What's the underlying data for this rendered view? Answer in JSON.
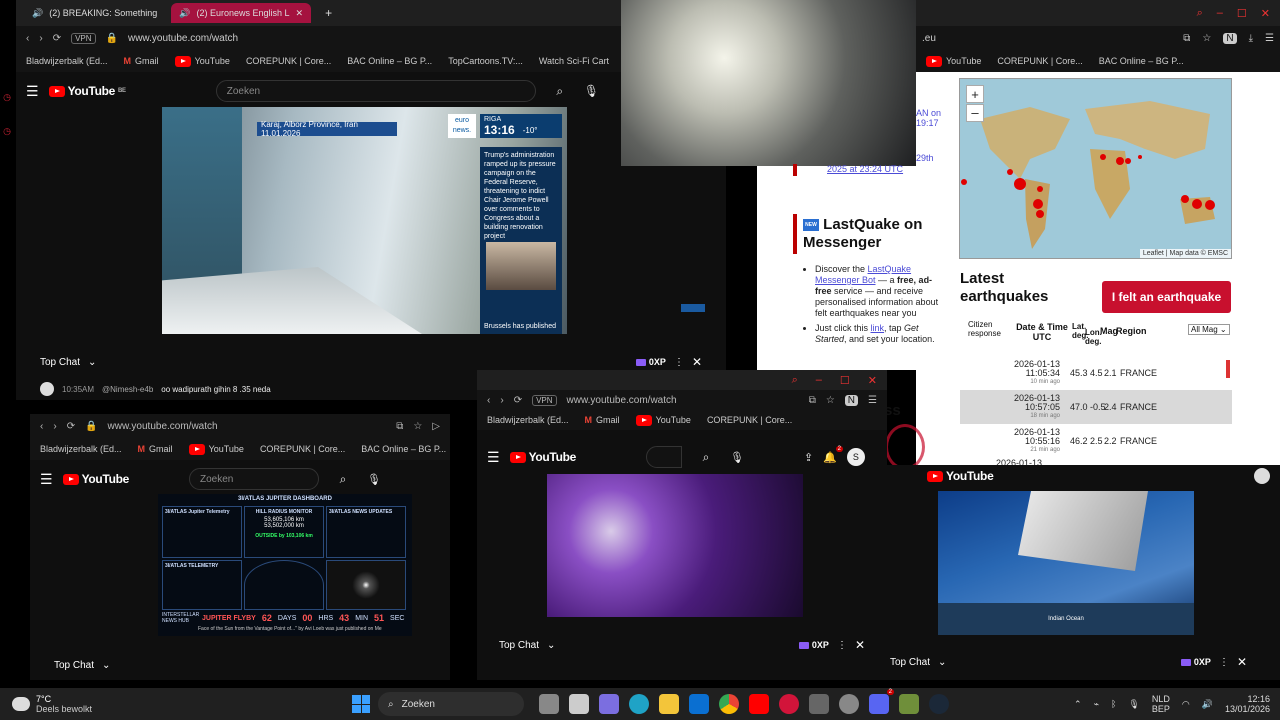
{
  "top_left_window": {
    "tabs": [
      {
        "label": "(2) BREAKING: Something"
      },
      {
        "label": "(2) Euronews English L"
      }
    ],
    "url": "www.youtube.com/watch",
    "vpn": "VPN",
    "bookmarks": [
      "Bladwijzerbalk (Ed...",
      "Gmail",
      "YouTube",
      "COREPUNK | Core...",
      "BAC Online – BG P...",
      "TopCartoons.TV:...",
      "Watch Sci-Fi Cart"
    ],
    "search_placeholder": "Zoeken",
    "yt_label": "YouTube",
    "yt_region": "BE",
    "video": {
      "location": "Karaj, Alborz Province, Iran 11.01.2026",
      "brand": "euro news.",
      "city": "RIGA",
      "time": "13:16",
      "temp": "-10°",
      "news_text": "Trump's administration ramped up its pressure campaign on the Federal Reserve, threatening to indict Chair Jerome Powell over comments to Congress about a building renovation project",
      "bottom_text": "Brussels has published"
    },
    "chat_label": "Top Chat",
    "xp_label": "0XP",
    "chat_message": {
      "time": "10:35AM",
      "user": "@Nimesh-e4b",
      "text": "oo wadipurath gihin 8 .35 neda"
    }
  },
  "right_window": {
    "url_fragment": ".eu",
    "bookmarks": [
      "YouTube",
      "COREPUNK | Core...",
      "BAC Online – BG P..."
    ],
    "date_links": [
      "AN on",
      "19:17",
      "29th",
      "2025 at 23:24 UTC"
    ],
    "lastquake_title": "LastQuake on Messenger",
    "bullet1_parts": [
      "Discover the ",
      "LastQuake Messenger Bot",
      " — a ",
      "free, ad-free",
      " service — and receive personalised information about felt earthquakes near you"
    ],
    "bullet2_parts": [
      "Just click this ",
      "link",
      ", tap ",
      "Get Started",
      ", and set your location."
    ],
    "map_attr": "Leaflet | Map data © EMSC",
    "latest_title": "Latest earthquakes",
    "felt_button": "I felt an earthquake",
    "col_headers": [
      "Citizen response",
      "Date & Time UTC",
      "Lat. deg.",
      "Lon. deg.",
      "Mag",
      "Region"
    ],
    "mag_filter": "All Mag",
    "rows": [
      {
        "date": "2026-01-13",
        "time": "11:05:34",
        "ago": "10 min ago",
        "lat": "45.3",
        "lon": "4.5",
        "mag": "2.1",
        "region": "FRANCE"
      },
      {
        "date": "2026-01-13",
        "time": "10:57:05",
        "ago": "18 min ago",
        "lat": "47.0",
        "lon": "-0.5",
        "mag": "2.4",
        "region": "FRANCE"
      },
      {
        "date": "2026-01-13",
        "time": "10:55:16",
        "ago": "21 min ago",
        "lat": "46.2",
        "lon": "2.5",
        "mag": "2.2",
        "region": "FRANCE"
      },
      {
        "date": "2026-01-13",
        "time": "",
        "ago": "",
        "lat": "",
        "lon": "",
        "mag": "",
        "region": ""
      }
    ],
    "partial_word": "ss"
  },
  "bottom_left_window": {
    "url": "www.youtube.com/watch",
    "bookmarks": [
      "Bladwijzerbalk (Ed...",
      "Gmail",
      "YouTube",
      "COREPUNK | Core...",
      "BAC Online – BG P..."
    ],
    "search_placeholder": "Zoeken",
    "dashboard": {
      "title": "3I/ATLAS JUPITER DASHBOARD",
      "panel1_title": "3I/ATLAS Jupiter Telemetry",
      "panel2_title": "HILL RADIUS MONITOR",
      "panel3_title": "3I/ATLAS NEWS UPDATES",
      "hill_value": "53,605,106 km",
      "hill_value2": "53,502,000 km",
      "outside": "OUTSIDE by 103,106 km",
      "panel4_title": "3I/ATLAS TELEMETRY",
      "flyby_label": "JUPITER FLYBY",
      "countdown": [
        "62",
        "DAYS",
        "00",
        "HRS",
        "43",
        "MIN",
        "51",
        "SEC"
      ],
      "brand": "INTERSTELLAR NEWS HUB",
      "ticker": "Face of the Sun from the Vantage Point of...\" by Avi Loeb was just published on Me"
    },
    "chat_label": "Top Chat"
  },
  "bottom_mid_window": {
    "url": "www.youtube.com/watch",
    "vpn": "VPN",
    "bookmarks": [
      "Bladwijzerbalk (Ed...",
      "Gmail",
      "YouTube",
      "COREPUNK | Core..."
    ],
    "notif_count": "2",
    "avatar": "S",
    "chat_label": "Top Chat",
    "xp_label": "0XP"
  },
  "bottom_right_window": {
    "chat_label": "Top Chat",
    "xp_label": "0XP",
    "map_label": "Indian Ocean"
  },
  "taskbar": {
    "temp": "7°C",
    "weather": "Deels bewolkt",
    "search": "Zoeken",
    "lang": "NLD",
    "layout": "BEP",
    "time": "12:16",
    "date": "13/01/2026",
    "discord_badge": "2"
  }
}
